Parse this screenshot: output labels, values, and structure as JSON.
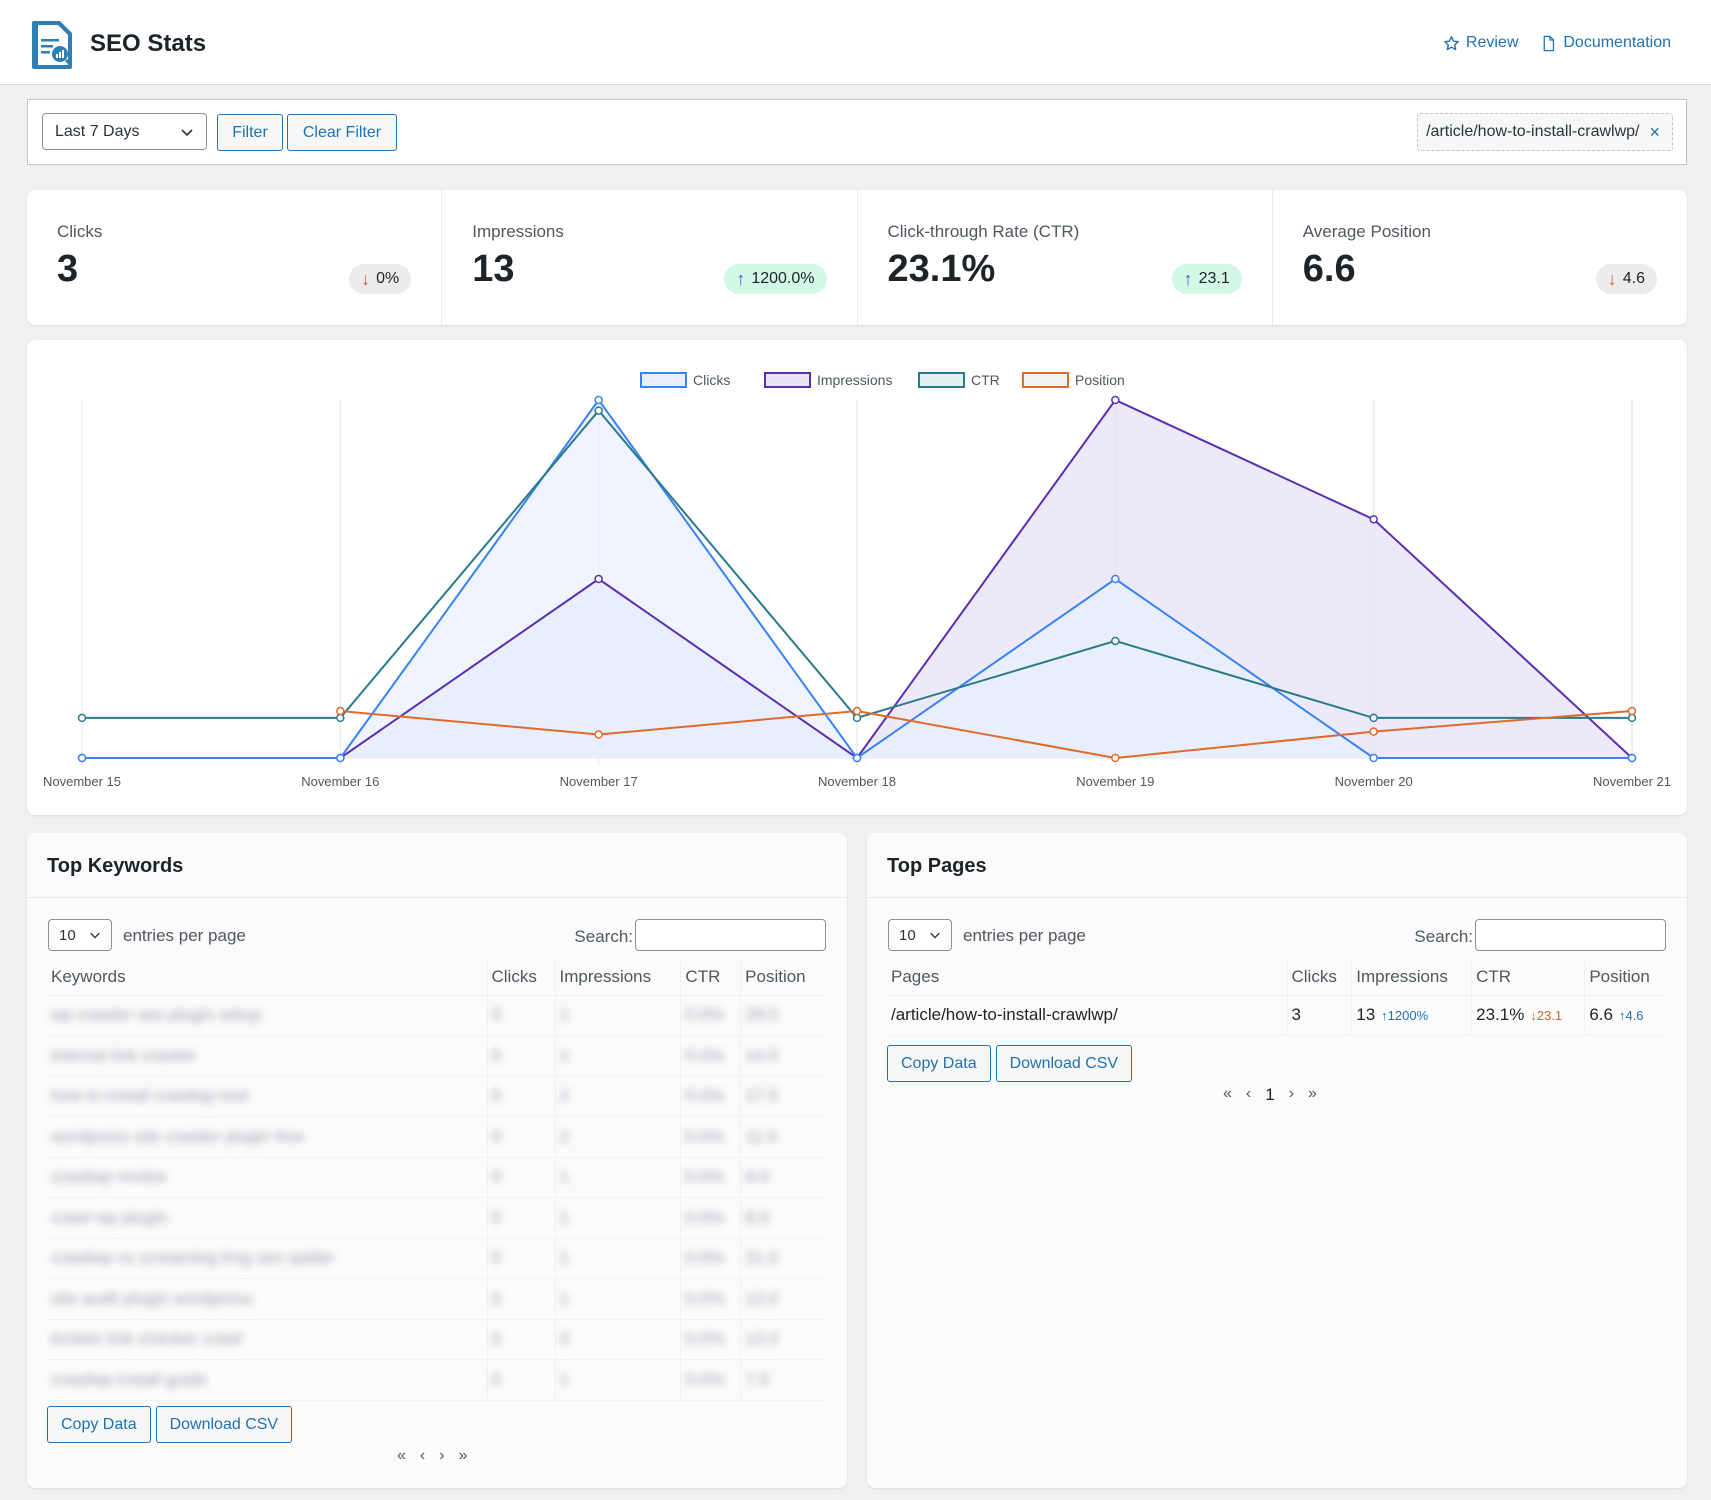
{
  "header": {
    "title": "SEO Stats",
    "links": [
      {
        "icon": "star-icon",
        "label": "Review"
      },
      {
        "icon": "document-icon",
        "label": "Documentation"
      }
    ]
  },
  "filter": {
    "range_selected": "Last 7 Days",
    "filter_label": "Filter",
    "clear_label": "Clear Filter",
    "active_filter": "/article/how-to-install-crawlwp/",
    "remove_icon": "×"
  },
  "stats": [
    {
      "label": "Clicks",
      "value": "3",
      "change": "0%",
      "direction": "down"
    },
    {
      "label": "Impressions",
      "value": "13",
      "change": "1200.0%",
      "direction": "up"
    },
    {
      "label": "Click-through Rate (CTR)",
      "value": "23.1%",
      "change": "23.1",
      "direction": "up"
    },
    {
      "label": "Average Position",
      "value": "6.6",
      "change": "4.6",
      "direction": "down"
    }
  ],
  "chart_data": {
    "type": "line",
    "title": "",
    "xlabel": "",
    "ylabel": "",
    "x": [
      "November 15",
      "November 16",
      "November 17",
      "November 18",
      "November 19",
      "November 20",
      "November 21"
    ],
    "legend_position": "top",
    "grid": "vertical",
    "y_axes_visible": false,
    "series": [
      {
        "name": "Clicks",
        "color": "#3b82f6",
        "fill": "#e8effd",
        "filled": true,
        "values": [
          0,
          0,
          2,
          0,
          1,
          0,
          0
        ],
        "ylim": [
          0,
          2
        ]
      },
      {
        "name": "Impressions",
        "color": "#5b2fb0",
        "fill": "#e6e1f5",
        "filled": true,
        "values": [
          0,
          0,
          3,
          0,
          6,
          4,
          0
        ],
        "ylim": [
          0,
          6
        ]
      },
      {
        "name": "CTR",
        "color": "#2a7a8c",
        "fill": "#e3f1f0",
        "filled": false,
        "values": [
          0,
          0,
          66.7,
          0,
          16.7,
          0,
          0
        ],
        "ylim": [
          -8.7,
          69
        ]
      },
      {
        "name": "Position",
        "color": "#e06a2c",
        "fill": "#f3f3f3",
        "filled": false,
        "values": [
          null,
          8,
          4,
          8,
          0,
          4.5,
          8
        ],
        "ylim": [
          0,
          61
        ]
      }
    ]
  },
  "keywords": {
    "title": "Top Keywords",
    "length_selected": "10",
    "length_label": "entries per page",
    "search_label": "Search:",
    "search_value": "",
    "columns": [
      "Keywords",
      "Clicks",
      "Impressions",
      "CTR",
      "Position"
    ],
    "rows": [
      [
        "wp crawler seo plugin setup",
        "0",
        "1",
        "0.0%",
        "29.0"
      ],
      [
        "internal link crawler",
        "0",
        "1",
        "0.0%",
        "14.0"
      ],
      [
        "how to install crawlwp tool",
        "0",
        "2",
        "0.0%",
        "17.5"
      ],
      [
        "wordpress site crawler plugin free",
        "0",
        "2",
        "0.0%",
        "11.5"
      ],
      [
        "crawlwp review",
        "0",
        "1",
        "0.0%",
        "9.0"
      ],
      [
        "crawl wp plugin",
        "0",
        "1",
        "0.0%",
        "8.0"
      ],
      [
        "crawlwp vs screaming frog seo spider",
        "0",
        "1",
        "0.0%",
        "31.0"
      ],
      [
        "site audit plugin wordpress",
        "0",
        "1",
        "0.0%",
        "12.0"
      ],
      [
        "broken link checker crawl",
        "0",
        "3",
        "0.0%",
        "13.3"
      ],
      [
        "crawlwp install guide",
        "0",
        "1",
        "0.0%",
        "7.0"
      ]
    ],
    "copy_label": "Copy Data",
    "csv_label": "Download CSV",
    "pager": [
      "«",
      "‹",
      "›",
      "»"
    ]
  },
  "pages": {
    "title": "Top Pages",
    "length_selected": "10",
    "length_label": "entries per page",
    "search_label": "Search:",
    "search_value": "",
    "columns": [
      "Pages",
      "Clicks",
      "Impressions",
      "CTR",
      "Position"
    ],
    "rows": [
      {
        "page": "/article/how-to-install-crawlwp/",
        "clicks": "3",
        "impressions": "13",
        "impressions_change": "↑1200%",
        "ctr": "23.1%",
        "ctr_change": "↓23.1",
        "position": "6.6",
        "position_change": "↑4.6"
      }
    ],
    "copy_label": "Copy Data",
    "csv_label": "Download CSV",
    "pager": [
      "«",
      "‹",
      "1",
      "›",
      "»"
    ]
  }
}
